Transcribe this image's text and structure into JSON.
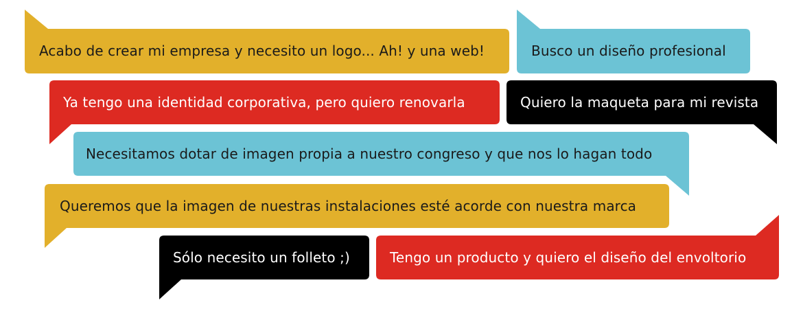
{
  "colors": {
    "yellow": "#e2b02b",
    "cyan": "#6cc3d5",
    "red": "#dd2a22",
    "black": "#000000"
  },
  "bubbles": [
    {
      "id": "logo-web",
      "text": "Acabo de crear mi empresa y necesito un logo... Ah! y una web!",
      "color": "yellow",
      "tail": "top-left"
    },
    {
      "id": "diseno-profesional",
      "text": "Busco un diseño profesional",
      "color": "cyan",
      "tail": "top-left"
    },
    {
      "id": "identidad-corporativa",
      "text": "Ya tengo una identidad corporativa, pero quiero renovarla",
      "color": "red",
      "tail": "bottom-left"
    },
    {
      "id": "maqueta-revista",
      "text": "Quiero la maqueta para mi revista",
      "color": "black",
      "tail": "bottom-right"
    },
    {
      "id": "congreso",
      "text": "Necesitamos dotar de imagen propia a nuestro congreso y que nos lo hagan todo",
      "color": "cyan",
      "tail": "bottom-right"
    },
    {
      "id": "instalaciones",
      "text": "Queremos que la imagen de nuestras instalaciones esté acorde con nuestra marca",
      "color": "yellow",
      "tail": "bottom-left"
    },
    {
      "id": "folleto",
      "text": "Sólo necesito un folleto ;)",
      "color": "black",
      "tail": "bottom-left"
    },
    {
      "id": "envoltorio",
      "text": "Tengo un producto y quiero el diseño del envoltorio",
      "color": "red",
      "tail": "top-right"
    }
  ]
}
